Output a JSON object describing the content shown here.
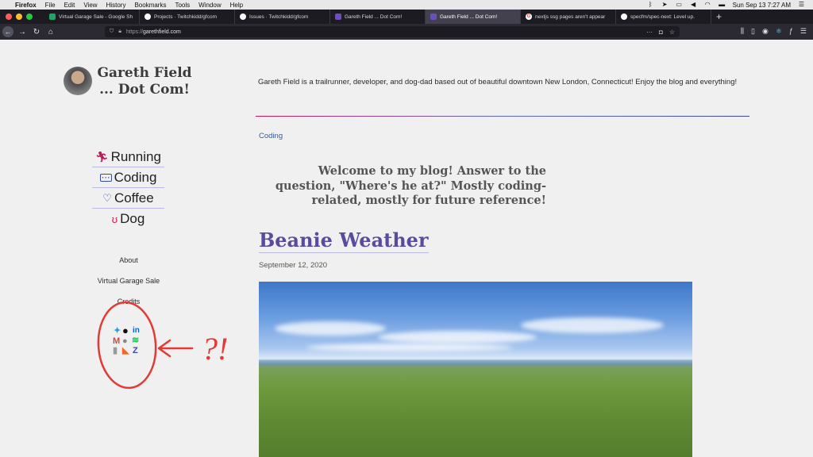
{
  "menubar": {
    "app": "Firefox",
    "items": [
      "File",
      "Edit",
      "View",
      "History",
      "Bookmarks",
      "Tools",
      "Window",
      "Help"
    ],
    "clock": "Sun Sep 13  7:27 AM"
  },
  "tabs": [
    {
      "label": "Virtual Garage Sale - Google Sh",
      "favicon_color": "#1fa463",
      "active": false
    },
    {
      "label": "Projects · Twitchkidd/gfcom",
      "favicon_color": "#ffffff",
      "active": false
    },
    {
      "label": "Issues · Twitchkidd/gfcom",
      "favicon_color": "#ffffff",
      "active": false
    },
    {
      "label": "Gareth Field ... Dot Com!",
      "favicon_color": "#6b4fbb",
      "active": false
    },
    {
      "label": "Gareth Field ... Dot Com!",
      "favicon_color": "#6b4fbb",
      "active": true
    },
    {
      "label": "nextjs ssg pages aren't appear",
      "favicon_color": "#ea4335",
      "active": false
    },
    {
      "label": "specfm/spec-next: Level up.",
      "favicon_color": "#ffffff",
      "active": false
    }
  ],
  "address": {
    "protocol": "https://",
    "host": "garethfield.com"
  },
  "site": {
    "title_line1": "Gareth Field",
    "title_line2": "... Dot Com!",
    "tagline": "Gareth Field is a trailrunner, developer, and dog-dad based out of beautiful downtown New London, Connecticut! Enjoy the blog and everything!"
  },
  "categories": [
    {
      "label": "Running",
      "icon": "running-icon",
      "glyph": "🏃",
      "color": "#c2185b"
    },
    {
      "label": "Coding",
      "icon": "laptop-icon",
      "glyph": "⌨",
      "color": "#3949ab"
    },
    {
      "label": "Coffee",
      "icon": "coffee-heart-icon",
      "glyph": "♡",
      "color": "#3949ab"
    },
    {
      "label": "Dog",
      "icon": "dog-icon",
      "glyph": "🐶",
      "color": "#c2185b"
    }
  ],
  "pages": [
    "About",
    "Virtual Garage Sale",
    "Credits"
  ],
  "social_icons": [
    "twitter-icon",
    "github-icon",
    "linkedin-icon",
    "gmail-icon",
    "apple-icon",
    "rss-icon",
    "spotify-icon",
    "dev-icon"
  ],
  "annotation": {
    "text": "?!",
    "color": "#e53935"
  },
  "post": {
    "category": "Coding",
    "welcome": "Welcome to my blog! Answer to the question, \"Where's he at?\" Mostly coding-related, mostly for future reference!",
    "title": "Beanie Weather",
    "date": "September 12, 2020"
  }
}
